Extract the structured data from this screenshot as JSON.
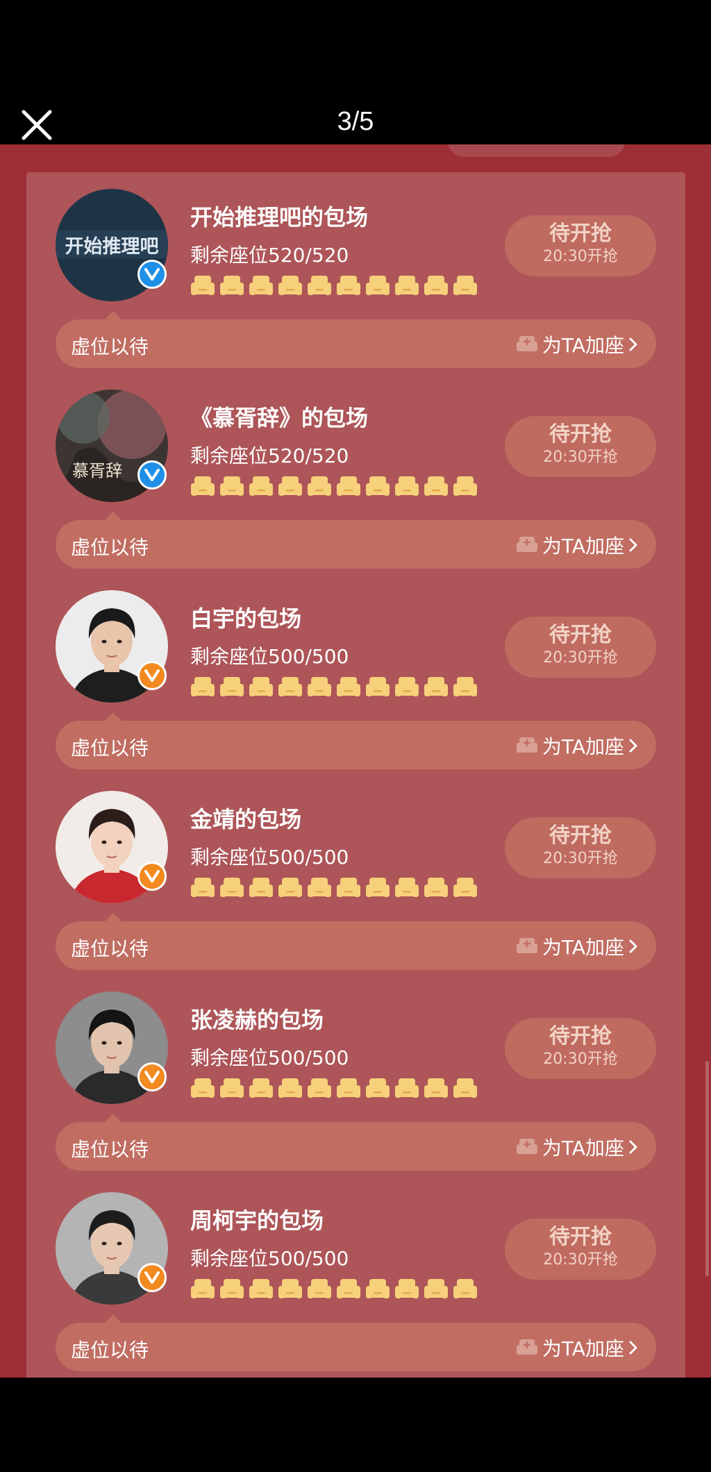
{
  "header": {
    "page_counter": "3/5"
  },
  "cards": [
    {
      "name": "开始推理吧的包场",
      "seats_text": "剩余座位520/520",
      "avatar_text": "开始推理吧",
      "badge_color": "#1e90e8",
      "button_title": "待开抢",
      "button_time": "20:30开抢",
      "bar_left": "虚位以待",
      "bar_right": "为TA加座"
    },
    {
      "name": "《慕胥辞》的包场",
      "seats_text": "剩余座位520/520",
      "avatar_text": "慕胥辞",
      "badge_color": "#1e90e8",
      "button_title": "待开抢",
      "button_time": "20:30开抢",
      "bar_left": "虚位以待",
      "bar_right": "为TA加座"
    },
    {
      "name": "白宇的包场",
      "seats_text": "剩余座位500/500",
      "badge_color": "#f28a1f",
      "button_title": "待开抢",
      "button_time": "20:30开抢",
      "bar_left": "虚位以待",
      "bar_right": "为TA加座"
    },
    {
      "name": "金靖的包场",
      "seats_text": "剩余座位500/500",
      "badge_color": "#f28a1f",
      "button_title": "待开抢",
      "button_time": "20:30开抢",
      "bar_left": "虚位以待",
      "bar_right": "为TA加座"
    },
    {
      "name": "张凌赫的包场",
      "seats_text": "剩余座位500/500",
      "badge_color": "#f28a1f",
      "button_title": "待开抢",
      "button_time": "20:30开抢",
      "bar_left": "虚位以待",
      "bar_right": "为TA加座"
    },
    {
      "name": "周柯宇的包场",
      "seats_text": "剩余座位500/500",
      "badge_color": "#f28a1f",
      "button_title": "待开抢",
      "button_time": "20:30开抢",
      "bar_left": "虚位以待",
      "bar_right": "为TA加座"
    }
  ],
  "icons": {
    "close": "close-icon",
    "seat": "sofa-seat-icon",
    "verified": "verified-v-icon",
    "add_seat": "sofa-plus-icon",
    "chevron": "chevron-right-icon"
  },
  "colors": {
    "page_bg": "#9d2e35",
    "panel_bg": "#ad5558",
    "bar_bg": "#c16d62",
    "button_bg": "#c06b60",
    "seat_color": "#f6d07a"
  }
}
